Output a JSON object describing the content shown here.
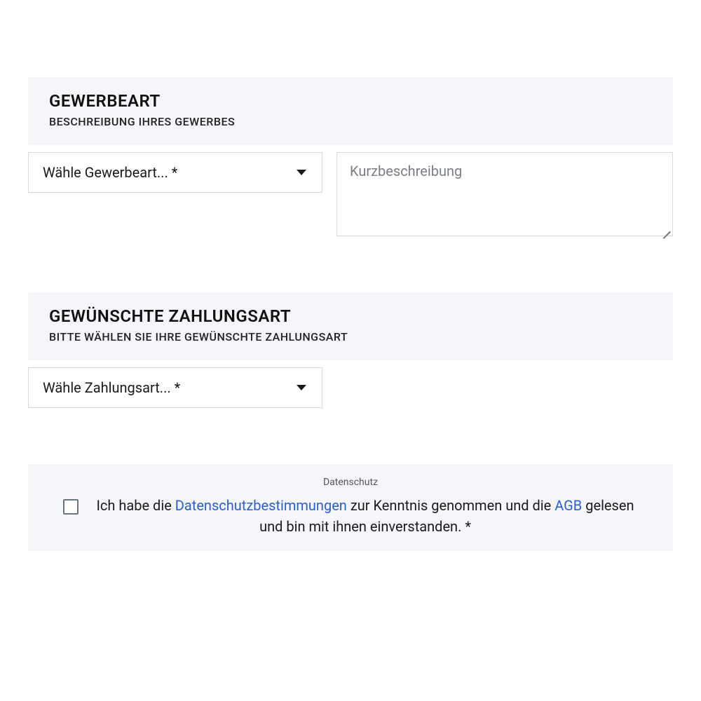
{
  "section1": {
    "title": "GEWERBEART",
    "subtitle": "BESCHREIBUNG IHRES GEWERBES",
    "select_label": "Wähle Gewerbeart... *",
    "description_placeholder": "Kurzbeschreibung"
  },
  "section2": {
    "title": "GEWÜNSCHTE ZAHLUNGSART",
    "subtitle": "BITTE WÄHLEN SIE IHRE GEWÜNSCHTE ZAHLUNGSART",
    "select_label": "Wähle Zahlungsart... *"
  },
  "privacy": {
    "heading": "Datenschutz",
    "text_before_link1": "Ich habe die ",
    "link1": "Datenschutzbestimmungen",
    "text_mid": " zur Kenntnis genommen und die ",
    "link2": "AGB",
    "text_after": " gelesen und bin mit ihnen einverstanden. *"
  }
}
